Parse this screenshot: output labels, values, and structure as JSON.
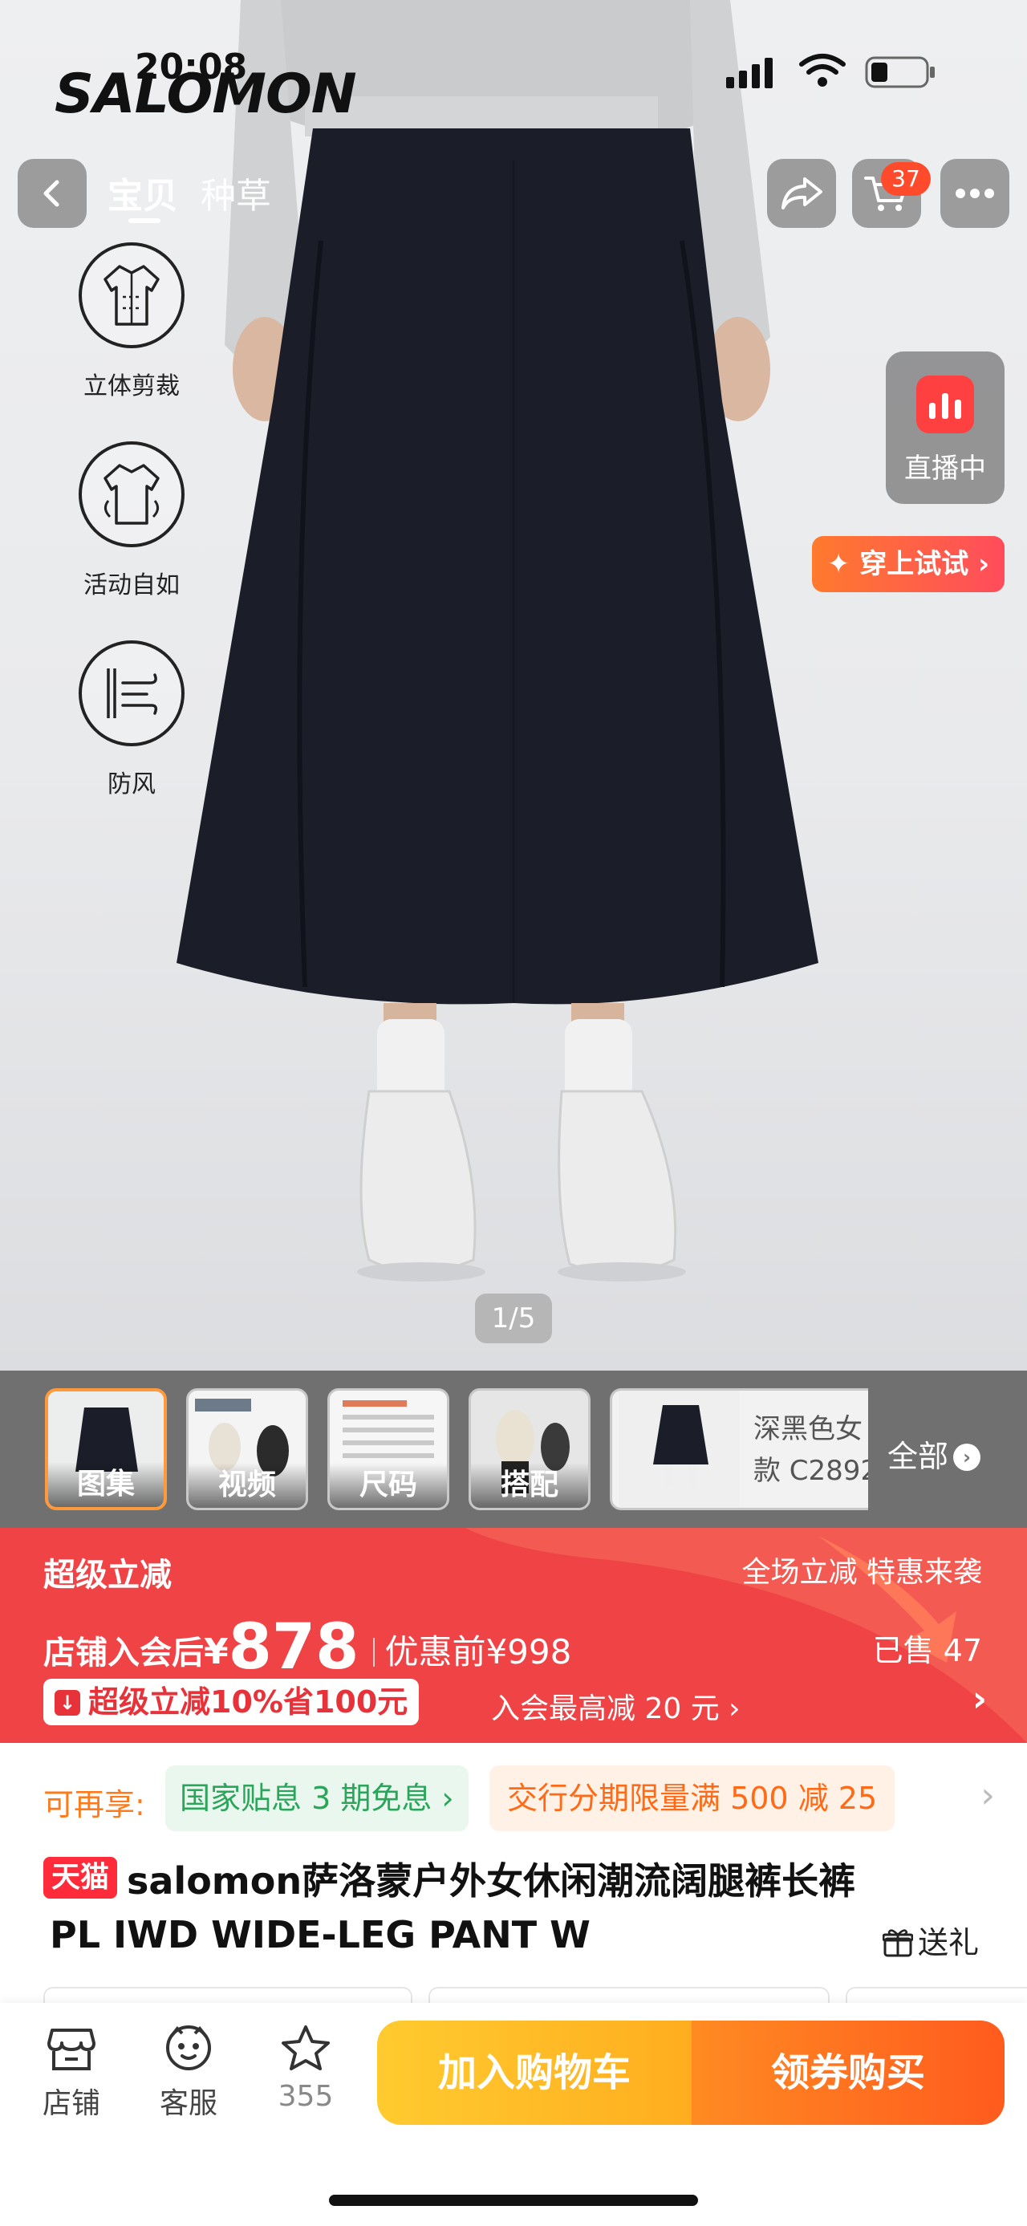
{
  "status": {
    "time": "20:08"
  },
  "brand": "SALOMON",
  "nav": {
    "tabs": [
      {
        "label": "宝贝"
      },
      {
        "label": "种草"
      }
    ],
    "cart_count": "37"
  },
  "features": [
    {
      "label": "立体剪裁",
      "icon": "3d-cut-jacket-icon"
    },
    {
      "label": "活动自如",
      "icon": "flexible-movement-icon"
    },
    {
      "label": "防风",
      "icon": "windproof-icon"
    }
  ],
  "live": {
    "label": "直播中"
  },
  "try_on": {
    "label": "✦ 穿上试试 ›"
  },
  "gallery": {
    "page_indicator": "1/5"
  },
  "thumbnails": [
    {
      "label": "图集"
    },
    {
      "label": "视频"
    },
    {
      "label": "尺码"
    },
    {
      "label": "搭配"
    }
  ],
  "variant_preview": {
    "line1": "深黑色女",
    "line2": "款 C2892"
  },
  "all_label": "全部",
  "promo": {
    "title": "超级立减",
    "right_text": "全场立减 特惠来袭",
    "price_prefix": "店铺入会后",
    "currency": "¥",
    "price": "878",
    "original_label": "优惠前¥998",
    "sold": "已售 47",
    "discount_chip": "超级立减10%省100元",
    "member_text": "入会最高减 20 元 ›"
  },
  "benefits": {
    "label": "可再享:",
    "national_subsidy": "国家贴息 3 期免息 ›",
    "installment": "交行分期限量满 500 减 25"
  },
  "product": {
    "store_badge": "天猫",
    "title_line1": "salomon萨洛蒙户外女休闲潮流阔腿裤长裤",
    "title_line2": "PL IWD WIDE-LEG PANT W",
    "gift_label": "送礼"
  },
  "bottom_bar": {
    "store_label": "店铺",
    "service_label": "客服",
    "favorite_count": "355",
    "add_to_cart": "加入购物车",
    "buy_with_coupon": "领券购买"
  },
  "colors": {
    "promo_red": "#f04346",
    "cart_yellow": "#ffb625",
    "buy_orange": "#ff6a1e",
    "tmall_red": "#ff2a3a"
  }
}
